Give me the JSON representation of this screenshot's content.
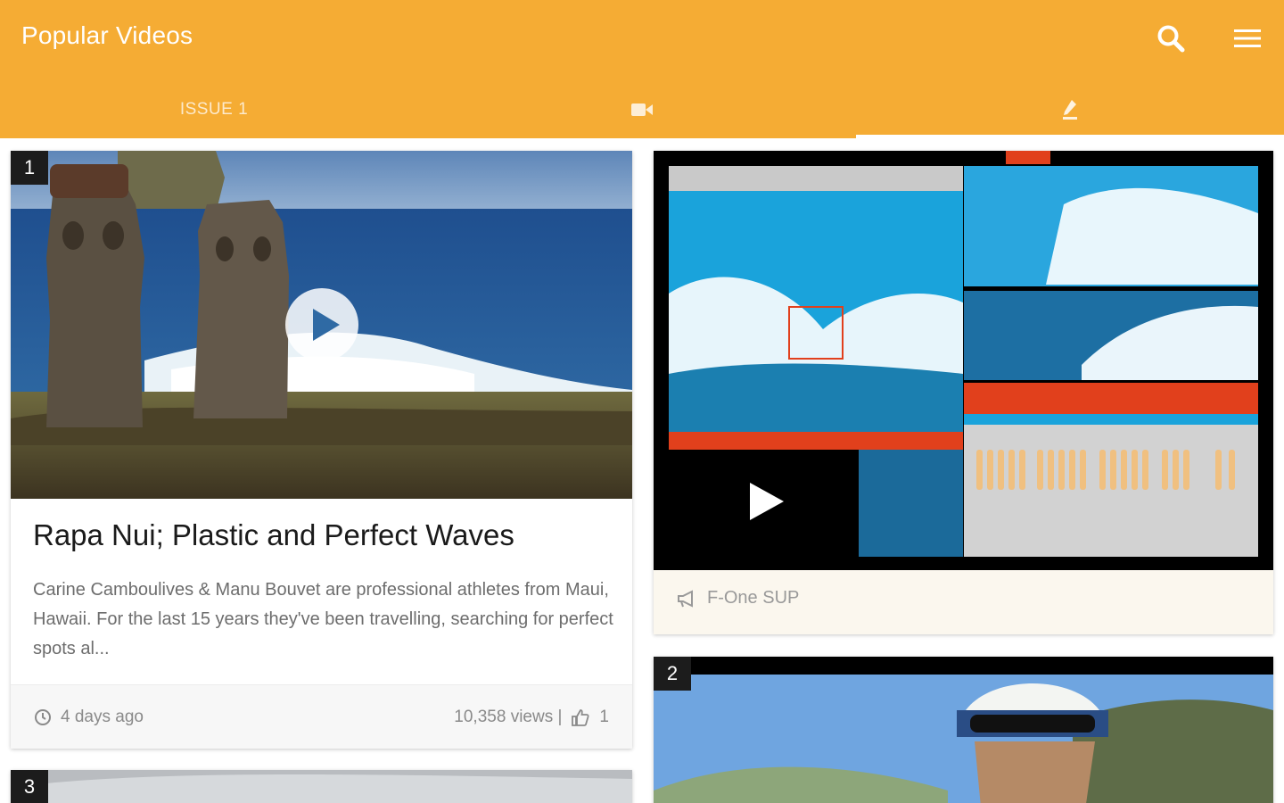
{
  "header": {
    "title": "Popular Videos",
    "background": "#F5AC34",
    "tabs": [
      {
        "label": "ISSUE 1",
        "icon": null,
        "active": false
      },
      {
        "label": "",
        "icon": "video-camera-icon",
        "active": false
      },
      {
        "label": "",
        "icon": "pen-icon",
        "active": true
      }
    ]
  },
  "cards": {
    "first": {
      "rank": "1",
      "title": "Rapa Nui; Plastic and Perfect Waves",
      "description": "Carine Camboulives & Manu Bouvet are professional athletes from Maui, Hawaii. For the last 15 years they've been travelling, searching for perfect spots al...",
      "time": "4 days ago",
      "views": "10,358 views |",
      "likes": "1"
    },
    "second": {
      "caption": "F-One SUP"
    },
    "third": {
      "rank": "3"
    },
    "fourth": {
      "rank": "2"
    }
  }
}
